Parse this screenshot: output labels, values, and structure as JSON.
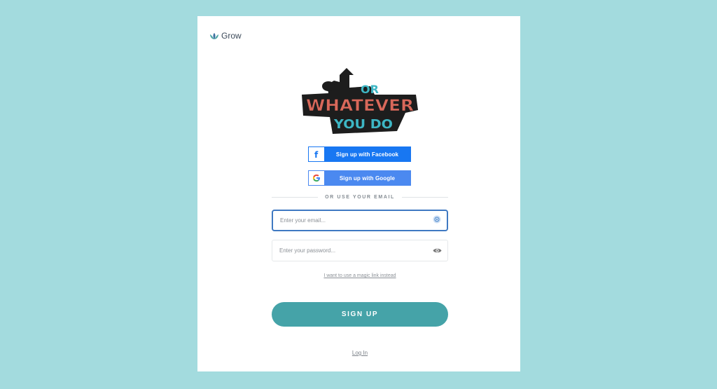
{
  "brand": {
    "name": "Grow",
    "icon": "lotus-icon"
  },
  "logo": {
    "line1": "OR",
    "line2": "WHATEVER",
    "line3": "YOU DO"
  },
  "social": {
    "facebook_label": "Sign up with Facebook",
    "google_label": "Sign up with Google"
  },
  "divider_text": "OR USE YOUR EMAIL",
  "form": {
    "email_placeholder": "Enter your email...",
    "password_placeholder": "Enter your password...",
    "magic_link": "I want to use a magic link instead",
    "signup_label": "SIGN UP",
    "login_link": "Log In"
  },
  "colors": {
    "background": "#a3dbde",
    "facebook": "#1877f2",
    "google": "#4b89f0",
    "signup": "#45a3a8",
    "focus_border": "#3f79c2"
  }
}
